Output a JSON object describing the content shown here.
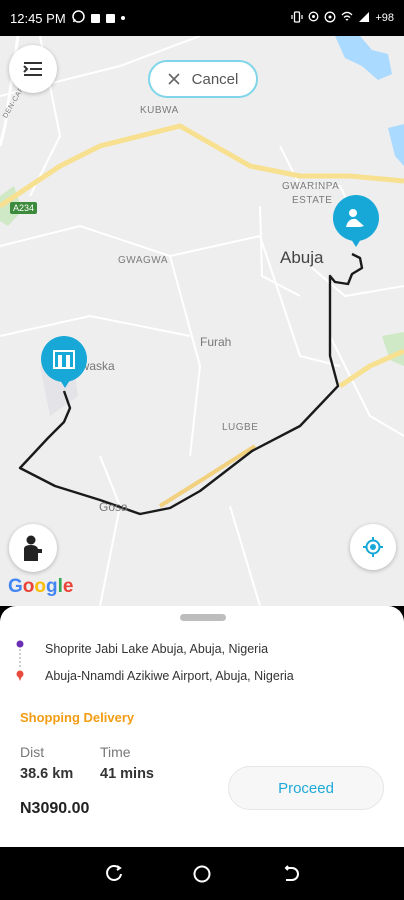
{
  "status_bar": {
    "time": "12:45 PM",
    "battery": "+98"
  },
  "map": {
    "cancel_label": "Cancel",
    "labels": {
      "kubwa": "KUBWA",
      "gwarinpa": "GWARINPA",
      "estate": "ESTATE",
      "abuja": "Abuja",
      "gwagwa": "GWAGWA",
      "furah": "Furah",
      "jiwaska": "iwaska",
      "lugbe": "LUGBE",
      "gosa": "Gosa",
      "road": "DEN-CAPITAL HW",
      "highway": "A234"
    },
    "google_logo": "Google",
    "colors": {
      "accent": "#17a8d8",
      "route": "#1a1a1a"
    }
  },
  "trip": {
    "pickup": "Shoprite Jabi Lake Abuja, Abuja, Nigeria",
    "dropoff": "Abuja-Nnamdi Azikiwe Airport, Abuja, Nigeria",
    "category": "Shopping Delivery",
    "dist_label": "Dist",
    "dist_value": "38.6 km",
    "time_label": "Time",
    "time_value": "41 mins",
    "price": "N3090.00",
    "proceed_label": "Proceed"
  },
  "nav": {
    "icons": [
      "recent-apps-icon",
      "home-icon",
      "back-icon"
    ]
  }
}
